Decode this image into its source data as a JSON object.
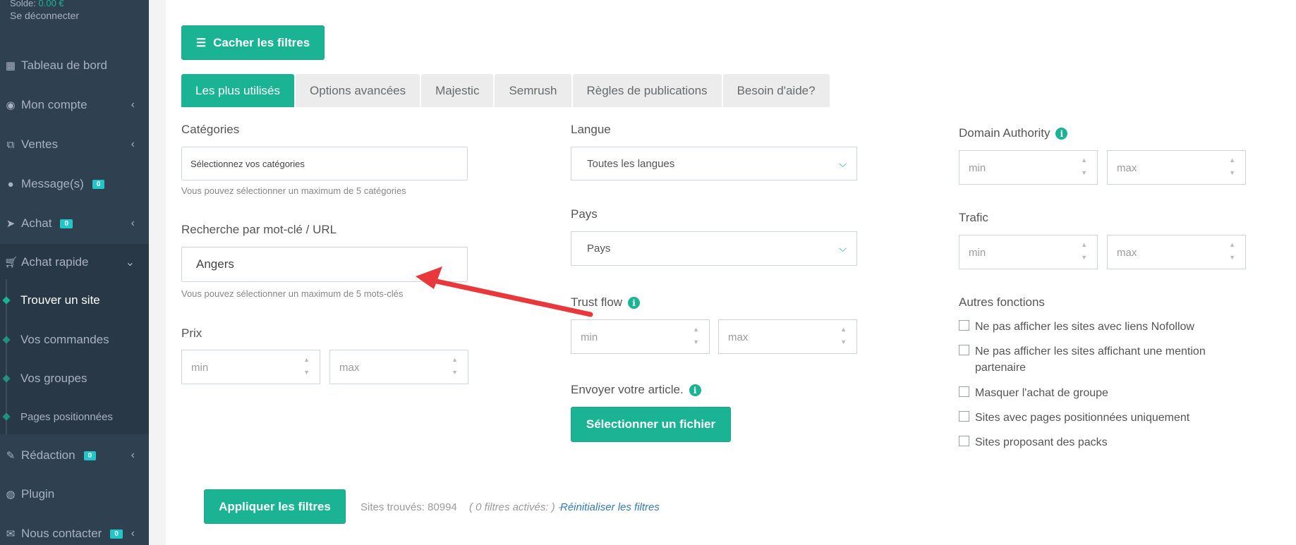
{
  "sidebar": {
    "balance_label": "Solde:",
    "balance_value": "0.00 €",
    "logout": "Se déconnecter",
    "items": [
      {
        "label": "Tableau de bord",
        "icon": "dashboard-icon"
      },
      {
        "label": "Mon compte",
        "icon": "user-icon",
        "chevron": "‹"
      },
      {
        "label": "Ventes",
        "icon": "sales-icon",
        "chevron": "‹"
      },
      {
        "label": "Message(s)",
        "icon": "messages-icon",
        "badge": "0"
      },
      {
        "label": "Achat",
        "icon": "paper-plane-icon",
        "badge": "0",
        "chevron": "‹"
      },
      {
        "label": "Achat rapide",
        "icon": "cart-icon",
        "chevron": "⌄"
      },
      {
        "label": "Rédaction",
        "icon": "pencil-icon",
        "badge": "0",
        "chevron": "‹"
      },
      {
        "label": "Plugin",
        "icon": "globe-icon"
      },
      {
        "label": "Nous contacter",
        "icon": "envelope-icon",
        "badge": "0",
        "chevron": "‹"
      }
    ],
    "submenu": [
      {
        "label": "Trouver un site",
        "active": true
      },
      {
        "label": "Vos commandes"
      },
      {
        "label": "Vos groupes"
      },
      {
        "label": "Pages positionnées"
      }
    ]
  },
  "toolbar": {
    "hide_filters_label": "Cacher les filtres"
  },
  "tabs": [
    {
      "label": "Les plus utilisés",
      "active": true
    },
    {
      "label": "Options avancées"
    },
    {
      "label": "Majestic"
    },
    {
      "label": "Semrush"
    },
    {
      "label": "Règles de publications"
    },
    {
      "label": "Besoin d'aide?"
    }
  ],
  "filters": {
    "categories": {
      "label": "Catégories",
      "value": "Sélectionnez vos catégories",
      "hint": "Vous pouvez sélectionner un maximum de 5 catégories"
    },
    "keyword": {
      "label": "Recherche par mot-clé / URL",
      "value": "Angers",
      "hint": "Vous pouvez sélectionner un maximum de 5 mots-clés"
    },
    "price": {
      "label": "Prix",
      "min": "min",
      "max": "max"
    },
    "language": {
      "label": "Langue",
      "value": "Toutes les langues"
    },
    "country": {
      "label": "Pays",
      "value": "Pays"
    },
    "trust_flow": {
      "label": "Trust flow",
      "min": "min",
      "max": "max"
    },
    "upload": {
      "label": "Envoyer votre article.",
      "button": "Sélectionner un fichier"
    },
    "domain_authority": {
      "label": "Domain Authority",
      "min": "min",
      "max": "max"
    },
    "traffic": {
      "label": "Trafic",
      "min": "min",
      "max": "max"
    },
    "other": {
      "label": "Autres fonctions",
      "options": [
        "Ne pas afficher les sites avec liens Nofollow",
        "Ne pas afficher les sites affichant une mention partenaire",
        "Masquer l'achat de groupe",
        "Sites avec pages positionnées uniquement",
        "Sites proposant des packs"
      ]
    }
  },
  "footer": {
    "apply_label": "Appliquer les filtres",
    "sites_found": "Sites trouvés: 80994",
    "filters_active": "( 0 filtres activés: ) -",
    "reset": "Réinitialiser les filtres"
  },
  "colors": {
    "accent": "#1ab394",
    "sidebar": "#2f4050",
    "badge": "#23c6c8",
    "arrow": "#e8383b"
  }
}
